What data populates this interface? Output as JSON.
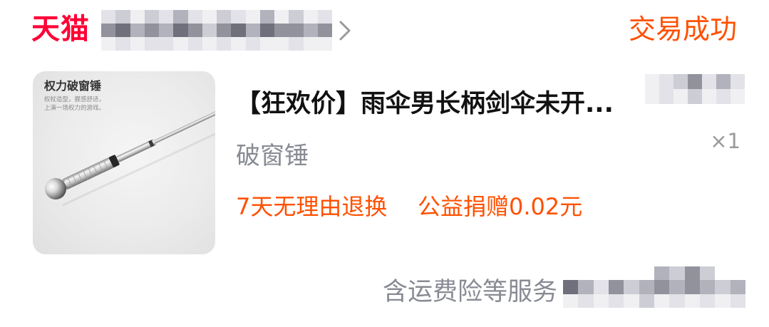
{
  "theme": {
    "brand_red": "#FF0036",
    "accent_orange": "#FF5000",
    "muted_text": "#888B94",
    "quantity_text": "#9A9A9A"
  },
  "header": {
    "logo": "天猫",
    "store_chevron_icon": "chevron-right-icon",
    "status": "交易成功"
  },
  "item": {
    "image": {
      "caption_title": "权力破窗锤",
      "caption_lines": [
        "权杖造型，握感舒适，",
        "上演一场权力的游戏。"
      ]
    },
    "title": "【狂欢价】雨伞男长柄剑伞未开...",
    "sku": "破窗锤",
    "quantity": "×1",
    "tags": [
      "7天无理由退换",
      "公益捐赠0.02元"
    ]
  },
  "footer": {
    "services": "含运费险等服务"
  }
}
